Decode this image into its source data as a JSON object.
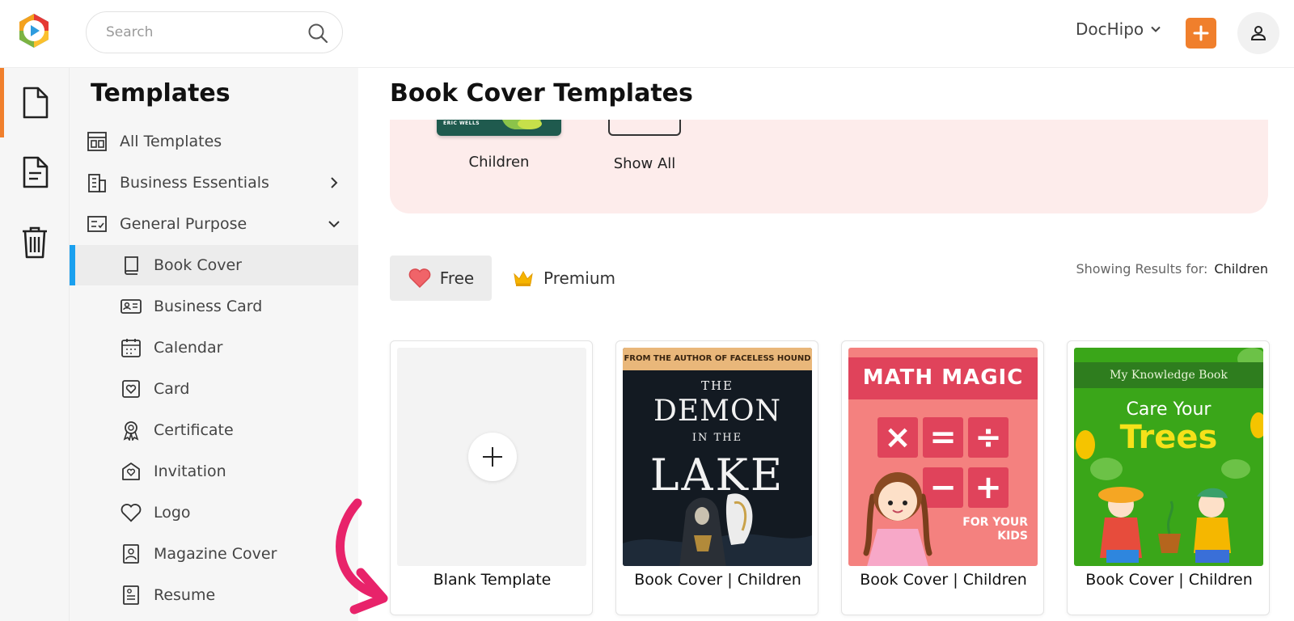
{
  "header": {
    "search_placeholder": "Search",
    "account_name": "DocHipo"
  },
  "rail": {
    "items": [
      {
        "name": "documents",
        "active": true
      },
      {
        "name": "drafts",
        "active": false
      },
      {
        "name": "trash",
        "active": false
      }
    ]
  },
  "sidebar": {
    "title": "Templates",
    "items": [
      {
        "label": "All Templates",
        "icon": "layout-icon"
      },
      {
        "label": "Business Essentials",
        "icon": "building-icon",
        "chevron": "right"
      },
      {
        "label": "General Purpose",
        "icon": "checklist-icon",
        "chevron": "down"
      },
      {
        "label": "Book Cover",
        "icon": "book-icon",
        "selected": true
      },
      {
        "label": "Business Card",
        "icon": "id-card-icon"
      },
      {
        "label": "Calendar",
        "icon": "calendar-icon"
      },
      {
        "label": "Card",
        "icon": "heart-card-icon"
      },
      {
        "label": "Certificate",
        "icon": "award-icon"
      },
      {
        "label": "Invitation",
        "icon": "envelope-heart-icon"
      },
      {
        "label": "Logo",
        "icon": "heart-icon"
      },
      {
        "label": "Magazine Cover",
        "icon": "portrait-icon"
      },
      {
        "label": "Resume",
        "icon": "resume-icon"
      }
    ]
  },
  "main": {
    "title": "Book Cover Templates",
    "categories": [
      {
        "label": "Children",
        "thumb_text": "ERIC WELLS"
      },
      {
        "label": "Show All"
      }
    ],
    "filters": {
      "free": "Free",
      "premium": "Premium"
    },
    "results": {
      "label": "Showing Results for:",
      "value": "Children"
    },
    "cards": [
      {
        "label": "Blank Template"
      },
      {
        "label": "Book Cover | Children",
        "band": "FROM THE AUTHOR OF FACELESS HOUND",
        "line1": "THE",
        "line2": "DEMON",
        "line3": "IN THE",
        "line4": "LAKE"
      },
      {
        "label": "Book Cover | Children",
        "title": "MATH MAGIC",
        "symbols": [
          "×",
          "=",
          "÷",
          "−",
          "+"
        ],
        "subtitle1": "FOR YOUR",
        "subtitle2": "KIDS"
      },
      {
        "label": "Book Cover | Children",
        "band": "My Knowledge Book",
        "title1": "Care Your",
        "title2": "Trees"
      }
    ]
  },
  "colors": {
    "accent_orange": "#f07f2c",
    "selection_blue": "#1aa0ef",
    "category_panel_bg": "#fdeceb",
    "annotation_arrow": "#e8236a"
  }
}
